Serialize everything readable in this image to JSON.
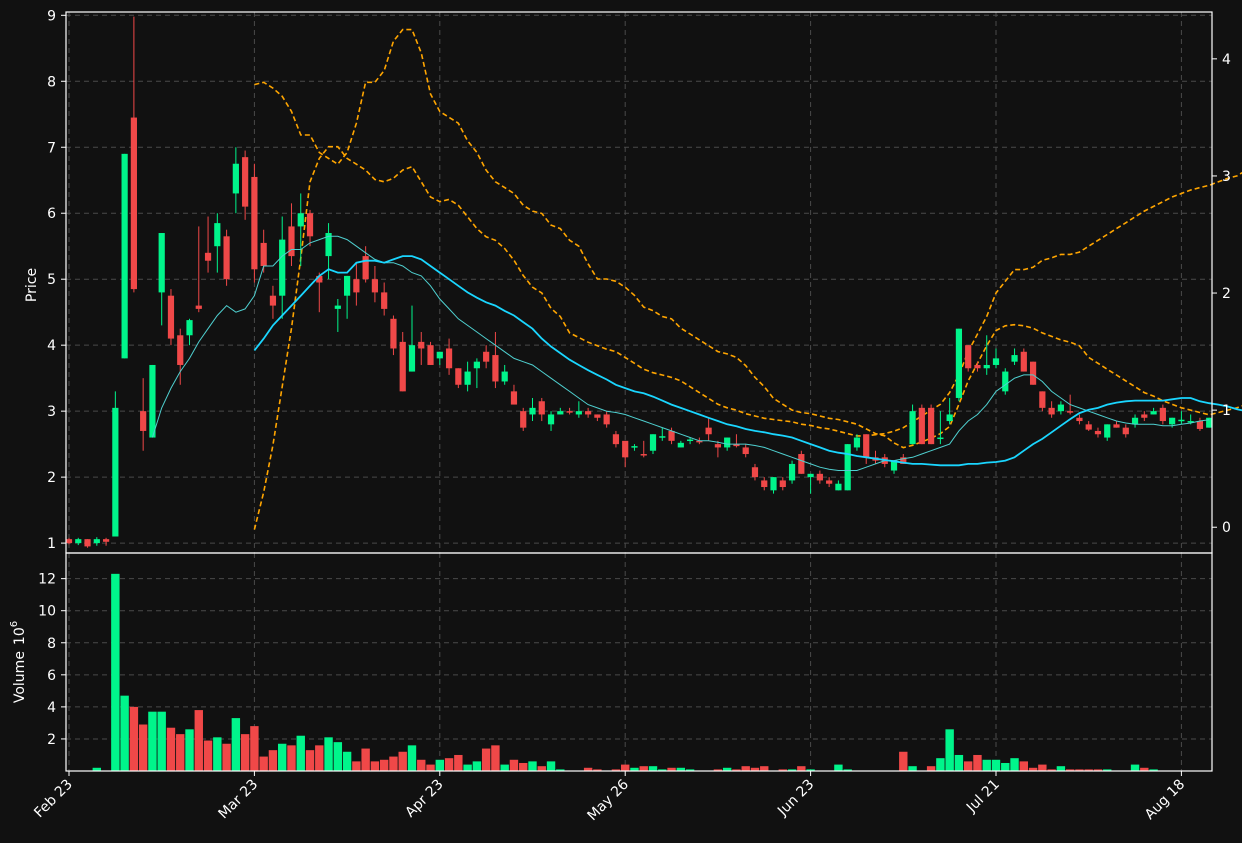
{
  "theme": {
    "background": "#111111",
    "up_color": "#00f58b",
    "down_color": "#f04848",
    "grid_color": "#4a4a4a",
    "ma_fast_color": "#4fd0d0",
    "ma_slow_color": "#1ad6ff",
    "band_color": "#ffa500"
  },
  "chart_data": {
    "type": "candlestick",
    "price_panel": {
      "ylabel": "Price",
      "ylim": [
        0.85,
        9.05
      ],
      "yticks": [
        1,
        2,
        3,
        4,
        5,
        6,
        7,
        8,
        9
      ],
      "right_axis": {
        "ylim": [
          -0.22,
          4.4
        ],
        "yticks": [
          0,
          1,
          2,
          3,
          4
        ]
      },
      "grid": true
    },
    "volume_panel": {
      "ylabel": "Volume",
      "ylabel_exponent": "10",
      "ylabel_power": "6",
      "ylim": [
        0,
        13.6
      ],
      "yticks": [
        2,
        4,
        6,
        8,
        10,
        12
      ],
      "grid": true
    },
    "x_tick_labels": [
      "Feb 23",
      "Mar 23",
      "Apr 23",
      "May 26",
      "Jun 23",
      "Jul 21",
      "Aug 18"
    ],
    "x_tick_index": [
      0,
      20,
      40,
      60,
      80,
      100,
      120
    ],
    "n_bars": 124,
    "ohlc": [
      [
        1.06,
        1.08,
        0.98,
        1.0
      ],
      [
        1.0,
        1.08,
        0.97,
        1.06
      ],
      [
        1.06,
        1.06,
        0.93,
        0.95
      ],
      [
        1.0,
        1.09,
        0.96,
        1.06
      ],
      [
        1.06,
        1.08,
        0.96,
        1.02
      ],
      [
        1.1,
        3.3,
        1.1,
        3.05
      ],
      [
        3.8,
        6.9,
        3.8,
        6.9
      ],
      [
        7.45,
        8.98,
        4.8,
        4.85
      ],
      [
        3.0,
        3.5,
        2.4,
        2.7
      ],
      [
        2.6,
        3.7,
        2.6,
        3.7
      ],
      [
        4.8,
        5.7,
        4.3,
        5.7
      ],
      [
        4.75,
        4.85,
        4.0,
        4.1
      ],
      [
        4.15,
        4.25,
        3.4,
        3.7
      ],
      [
        4.15,
        4.4,
        4.0,
        4.38
      ],
      [
        4.6,
        5.8,
        4.5,
        4.55
      ],
      [
        5.4,
        5.95,
        5.1,
        5.28
      ],
      [
        5.5,
        6.0,
        5.1,
        5.85
      ],
      [
        5.65,
        5.75,
        4.9,
        5.0
      ],
      [
        6.3,
        7.0,
        6.0,
        6.75
      ],
      [
        6.85,
        6.95,
        5.9,
        6.1
      ],
      [
        6.55,
        6.75,
        4.95,
        5.15
      ],
      [
        5.55,
        5.75,
        5.1,
        5.2
      ],
      [
        4.75,
        4.9,
        4.4,
        4.6
      ],
      [
        4.75,
        5.95,
        4.4,
        5.6
      ],
      [
        5.8,
        6.15,
        5.2,
        5.35
      ],
      [
        5.8,
        6.3,
        5.2,
        6.0
      ],
      [
        6.0,
        6.05,
        5.5,
        5.65
      ],
      [
        5.05,
        5.1,
        4.5,
        4.95
      ],
      [
        5.35,
        5.85,
        5.0,
        5.7
      ],
      [
        4.55,
        4.7,
        4.2,
        4.6
      ],
      [
        4.75,
        5.05,
        4.4,
        5.05
      ],
      [
        5.0,
        5.25,
        4.6,
        4.8
      ],
      [
        5.35,
        5.5,
        4.95,
        5.0
      ],
      [
        5.0,
        5.2,
        4.65,
        4.8
      ],
      [
        4.8,
        4.95,
        4.45,
        4.55
      ],
      [
        4.4,
        4.45,
        3.85,
        3.95
      ],
      [
        4.05,
        4.2,
        3.3,
        3.3
      ],
      [
        3.6,
        4.6,
        3.6,
        4.0
      ],
      [
        4.05,
        4.2,
        3.7,
        3.95
      ],
      [
        4.0,
        4.05,
        3.7,
        3.7
      ],
      [
        3.8,
        3.9,
        3.7,
        3.9
      ],
      [
        3.95,
        4.1,
        3.55,
        3.65
      ],
      [
        3.65,
        3.65,
        3.35,
        3.4
      ],
      [
        3.4,
        3.75,
        3.3,
        3.6
      ],
      [
        3.65,
        3.8,
        3.35,
        3.75
      ],
      [
        3.9,
        4.0,
        3.65,
        3.75
      ],
      [
        3.85,
        4.2,
        3.35,
        3.45
      ],
      [
        3.45,
        3.7,
        3.4,
        3.6
      ],
      [
        3.3,
        3.4,
        3.1,
        3.1
      ],
      [
        3.0,
        3.05,
        2.7,
        2.75
      ],
      [
        2.95,
        3.2,
        2.85,
        3.05
      ],
      [
        3.15,
        3.2,
        2.85,
        2.95
      ],
      [
        2.8,
        3.0,
        2.7,
        2.95
      ],
      [
        2.95,
        3.05,
        2.95,
        3.0
      ],
      [
        3.0,
        3.05,
        2.95,
        2.98
      ],
      [
        2.95,
        3.15,
        2.9,
        3.0
      ],
      [
        3.0,
        3.05,
        2.9,
        2.95
      ],
      [
        2.95,
        2.95,
        2.85,
        2.9
      ],
      [
        2.95,
        3.0,
        2.75,
        2.8
      ],
      [
        2.65,
        2.7,
        2.45,
        2.5
      ],
      [
        2.55,
        2.55,
        2.15,
        2.3
      ],
      [
        2.45,
        2.5,
        2.4,
        2.47
      ],
      [
        2.35,
        2.55,
        2.3,
        2.33
      ],
      [
        2.4,
        2.65,
        2.35,
        2.65
      ],
      [
        2.6,
        2.75,
        2.55,
        2.62
      ],
      [
        2.7,
        2.75,
        2.5,
        2.55
      ],
      [
        2.45,
        2.55,
        2.45,
        2.52
      ],
      [
        2.55,
        2.6,
        2.5,
        2.57
      ],
      [
        2.55,
        2.6,
        2.5,
        2.53
      ],
      [
        2.75,
        2.9,
        2.55,
        2.65
      ],
      [
        2.5,
        2.55,
        2.3,
        2.45
      ],
      [
        2.45,
        2.6,
        2.4,
        2.6
      ],
      [
        2.5,
        2.65,
        2.45,
        2.47
      ],
      [
        2.45,
        2.5,
        2.3,
        2.35
      ],
      [
        2.15,
        2.2,
        1.95,
        2.0
      ],
      [
        1.95,
        2.0,
        1.8,
        1.85
      ],
      [
        1.8,
        2.0,
        1.75,
        2.0
      ],
      [
        1.95,
        2.0,
        1.8,
        1.85
      ],
      [
        1.95,
        2.25,
        1.9,
        2.2
      ],
      [
        2.35,
        2.4,
        2.05,
        2.05
      ],
      [
        2.0,
        2.05,
        1.75,
        2.05
      ],
      [
        2.05,
        2.1,
        1.9,
        1.95
      ],
      [
        1.95,
        2.0,
        1.85,
        1.9
      ],
      [
        1.8,
        1.95,
        1.8,
        1.9
      ],
      [
        1.8,
        2.5,
        1.8,
        2.5
      ],
      [
        2.45,
        2.65,
        2.4,
        2.6
      ],
      [
        2.65,
        2.65,
        2.2,
        2.3
      ],
      [
        2.3,
        2.4,
        2.2,
        2.25
      ],
      [
        2.3,
        2.35,
        2.15,
        2.2
      ],
      [
        2.1,
        2.25,
        2.05,
        2.25
      ],
      [
        2.3,
        2.35,
        2.2,
        2.2
      ],
      [
        2.5,
        3.1,
        2.5,
        3.0
      ],
      [
        3.05,
        3.1,
        2.5,
        2.5
      ],
      [
        3.05,
        3.1,
        2.5,
        2.5
      ],
      [
        2.6,
        3.0,
        2.5,
        2.6
      ],
      [
        2.85,
        3.2,
        2.8,
        2.95
      ],
      [
        3.2,
        4.25,
        3.15,
        4.25
      ],
      [
        4.0,
        4.0,
        3.6,
        3.65
      ],
      [
        3.7,
        3.75,
        3.6,
        3.65
      ],
      [
        3.65,
        4.15,
        3.55,
        3.7
      ],
      [
        3.7,
        3.95,
        3.65,
        3.8
      ],
      [
        3.3,
        3.65,
        3.25,
        3.6
      ],
      [
        3.75,
        3.95,
        3.7,
        3.85
      ],
      [
        3.9,
        3.95,
        3.6,
        3.6
      ],
      [
        3.75,
        3.75,
        3.4,
        3.4
      ],
      [
        3.3,
        3.3,
        3.0,
        3.05
      ],
      [
        3.05,
        3.15,
        2.9,
        2.95
      ],
      [
        3.0,
        3.15,
        2.95,
        3.1
      ],
      [
        3.0,
        3.25,
        2.95,
        2.98
      ],
      [
        2.9,
        2.95,
        2.8,
        2.85
      ],
      [
        2.8,
        2.85,
        2.7,
        2.72
      ],
      [
        2.7,
        2.75,
        2.6,
        2.65
      ],
      [
        2.6,
        2.8,
        2.55,
        2.8
      ],
      [
        2.8,
        2.85,
        2.75,
        2.75
      ],
      [
        2.75,
        2.8,
        2.6,
        2.65
      ],
      [
        2.8,
        2.95,
        2.75,
        2.9
      ],
      [
        2.95,
        3.0,
        2.85,
        2.9
      ],
      [
        2.95,
        3.05,
        2.95,
        3.0
      ],
      [
        3.05,
        3.1,
        2.8,
        2.85
      ],
      [
        2.8,
        2.9,
        2.75,
        2.9
      ],
      [
        2.85,
        3.0,
        2.8,
        2.87
      ],
      [
        2.85,
        2.95,
        2.8,
        2.85
      ],
      [
        2.85,
        2.9,
        2.7,
        2.73
      ],
      [
        2.75,
        2.9,
        2.75,
        2.9
      ]
    ],
    "volume": [
      0.0,
      0.0,
      0.0,
      0.2,
      0.0,
      12.3,
      4.7,
      4.0,
      2.9,
      3.7,
      3.7,
      2.7,
      2.3,
      2.6,
      3.8,
      1.9,
      2.1,
      1.7,
      3.3,
      2.3,
      2.8,
      0.9,
      1.3,
      1.7,
      1.6,
      2.2,
      1.3,
      1.6,
      2.1,
      1.8,
      1.2,
      0.6,
      1.4,
      0.6,
      0.7,
      0.9,
      1.2,
      1.6,
      0.7,
      0.4,
      0.7,
      0.8,
      1.0,
      0.4,
      0.6,
      1.4,
      1.6,
      0.4,
      0.7,
      0.5,
      0.6,
      0.3,
      0.6,
      0.1,
      0.0,
      0.0,
      0.2,
      0.1,
      0.0,
      0.1,
      0.4,
      0.2,
      0.3,
      0.3,
      0.1,
      0.2,
      0.2,
      0.1,
      0.0,
      0.0,
      0.1,
      0.2,
      0.1,
      0.3,
      0.2,
      0.3,
      0.0,
      0.1,
      0.1,
      0.3,
      0.1,
      0.0,
      0.0,
      0.4,
      0.1,
      0.0,
      0.0,
      0.0,
      0.0,
      0.0,
      1.2,
      0.3,
      0.0,
      0.3,
      0.8,
      2.6,
      1.0,
      0.6,
      1.0,
      0.7,
      0.7,
      0.5,
      0.8,
      0.6,
      0.2,
      0.4,
      0.1,
      0.3,
      0.1,
      0.1,
      0.1,
      0.1,
      0.1,
      0.0,
      0.0,
      0.4,
      0.2,
      0.1,
      0.0,
      0.0,
      0.0,
      0.0,
      0.0,
      0.0
    ],
    "ma_fast_start": 9,
    "ma_fast": [
      2.6,
      3.05,
      3.35,
      3.6,
      3.8,
      4.05,
      4.25,
      4.45,
      4.6,
      4.5,
      4.55,
      4.75,
      5.2,
      5.2,
      5.35,
      5.45,
      5.45,
      5.55,
      5.6,
      5.65,
      5.65,
      5.6,
      5.5,
      5.4,
      5.3,
      5.25,
      5.25,
      5.2,
      5.1,
      5.05,
      4.9,
      4.7,
      4.55,
      4.4,
      4.3,
      4.2,
      4.1,
      4.0,
      3.9,
      3.8,
      3.75,
      3.7,
      3.6,
      3.5,
      3.4,
      3.3,
      3.2,
      3.1,
      3.05,
      3.0,
      2.98,
      2.95,
      2.9,
      2.85,
      2.8,
      2.75,
      2.7,
      2.65,
      2.6,
      2.55,
      2.55,
      2.53,
      2.5,
      2.5,
      2.5,
      2.48,
      2.45,
      2.4,
      2.35,
      2.3,
      2.25,
      2.2,
      2.15,
      2.12,
      2.1,
      2.1,
      2.1,
      2.15,
      2.2,
      2.25,
      2.25,
      2.28,
      2.3,
      2.35,
      2.4,
      2.45,
      2.5,
      2.7,
      2.85,
      2.95,
      3.1,
      3.3,
      3.4,
      3.5,
      3.55,
      3.55,
      3.45,
      3.3,
      3.2,
      3.1,
      3.05,
      3.0,
      2.95,
      2.9,
      2.85,
      2.82,
      2.8,
      2.8,
      2.8,
      2.78,
      2.78,
      2.8,
      2.82,
      2.85,
      2.87
    ],
    "ma_slow_start": 20,
    "ma_slow": [
      3.92,
      4.1,
      4.3,
      4.45,
      4.6,
      4.75,
      4.9,
      5.05,
      5.15,
      5.1,
      5.1,
      5.25,
      5.28,
      5.28,
      5.25,
      5.3,
      5.35,
      5.35,
      5.3,
      5.2,
      5.1,
      5.0,
      4.9,
      4.8,
      4.72,
      4.65,
      4.6,
      4.52,
      4.45,
      4.35,
      4.25,
      4.1,
      3.98,
      3.88,
      3.78,
      3.7,
      3.62,
      3.55,
      3.48,
      3.4,
      3.35,
      3.3,
      3.27,
      3.22,
      3.16,
      3.1,
      3.05,
      3.0,
      2.95,
      2.9,
      2.85,
      2.8,
      2.77,
      2.73,
      2.7,
      2.68,
      2.65,
      2.63,
      2.6,
      2.55,
      2.5,
      2.45,
      2.4,
      2.37,
      2.35,
      2.32,
      2.3,
      2.28,
      2.26,
      2.24,
      2.22,
      2.2,
      2.2,
      2.19,
      2.18,
      2.18,
      2.18,
      2.2,
      2.2,
      2.22,
      2.23,
      2.25,
      2.3,
      2.4,
      2.5,
      2.58,
      2.68,
      2.78,
      2.88,
      2.97,
      3.02,
      3.05,
      3.1,
      3.13,
      3.15,
      3.16,
      3.16,
      3.16,
      3.16,
      3.18,
      3.2,
      3.2,
      3.15,
      3.12,
      3.1,
      3.07,
      3.03,
      3.0,
      2.97,
      2.93,
      2.9,
      2.86,
      2.84
    ],
    "band_start": 20,
    "band_upper": [
      3.78,
      3.8,
      3.75,
      3.68,
      3.55,
      3.35,
      3.35,
      3.2,
      3.15,
      3.1,
      3.2,
      3.45,
      3.8,
      3.8,
      3.9,
      4.15,
      4.25,
      4.25,
      4.05,
      3.7,
      3.55,
      3.5,
      3.45,
      3.3,
      3.2,
      3.05,
      2.95,
      2.9,
      2.85,
      2.75,
      2.7,
      2.68,
      2.58,
      2.55,
      2.45,
      2.4,
      2.25,
      2.12,
      2.12,
      2.1,
      2.05,
      1.98,
      1.88,
      1.85,
      1.8,
      1.78,
      1.7,
      1.65,
      1.6,
      1.55,
      1.5,
      1.48,
      1.45,
      1.38,
      1.28,
      1.2,
      1.1,
      1.05,
      1.0,
      0.98,
      0.97,
      0.95,
      0.93,
      0.92,
      0.9,
      0.88,
      0.84,
      0.8,
      0.78,
      0.72,
      0.68,
      0.7,
      0.73,
      0.76,
      0.8,
      0.86,
      1.05,
      1.25,
      1.4,
      1.55,
      1.68,
      1.72,
      1.73,
      1.72,
      1.7,
      1.66,
      1.63,
      1.6,
      1.58,
      1.55,
      1.45,
      1.4,
      1.35,
      1.3,
      1.25,
      1.2,
      1.15,
      1.12,
      1.08,
      1.05,
      1.02,
      1.0,
      0.98,
      0.96,
      0.98,
      1.0,
      1.02,
      1.05,
      1.07,
      1.1,
      1.12,
      1.07,
      1.05
    ],
    "band_mid": [
      -0.02,
      0.3,
      0.7,
      1.2,
      1.7,
      2.3,
      2.95,
      3.15,
      3.25,
      3.25,
      3.15,
      3.1,
      3.05,
      2.97,
      2.95,
      2.98,
      3.05,
      3.08,
      2.95,
      2.82,
      2.78,
      2.8,
      2.75,
      2.65,
      2.55,
      2.48,
      2.45,
      2.38,
      2.28,
      2.15,
      2.05,
      2.0,
      1.87,
      1.8,
      1.66,
      1.62,
      1.58,
      1.55,
      1.52,
      1.5,
      1.45,
      1.4,
      1.35,
      1.32,
      1.3,
      1.28,
      1.25,
      1.2,
      1.15,
      1.1,
      1.05,
      1.02,
      1.0,
      0.97,
      0.95,
      0.93,
      0.92,
      0.91,
      0.9,
      0.88,
      0.87,
      0.85,
      0.84,
      0.82,
      0.8,
      0.78,
      0.78,
      0.79,
      0.8,
      0.82,
      0.85,
      0.9,
      0.95,
      1.0,
      1.05,
      1.15,
      1.3,
      1.5,
      1.65,
      1.8,
      2.0,
      2.1,
      2.2,
      2.2,
      2.22,
      2.28,
      2.3,
      2.33,
      2.33,
      2.35,
      2.4,
      2.45,
      2.5,
      2.55,
      2.6,
      2.65,
      2.7,
      2.74,
      2.78,
      2.82,
      2.85,
      2.88,
      2.9,
      2.92,
      2.95,
      2.98,
      3.0,
      3.05,
      3.1,
      3.15,
      3.2,
      3.25,
      3.3
    ]
  }
}
